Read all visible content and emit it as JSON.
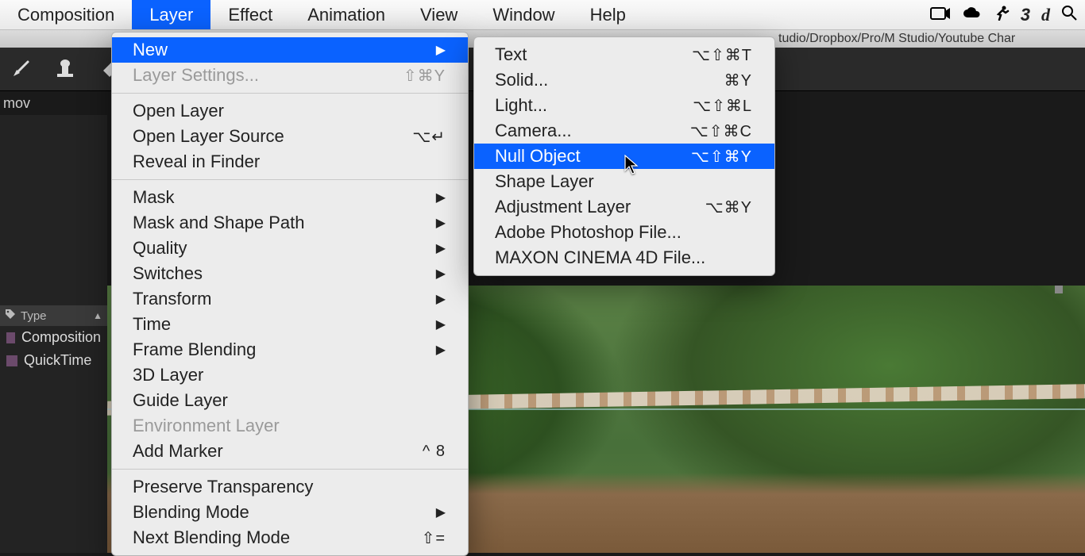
{
  "menubar": {
    "items": [
      "Composition",
      "Layer",
      "Effect",
      "Animation",
      "View",
      "Window",
      "Help"
    ],
    "active_index": 1
  },
  "titlebar": {
    "path": "tudio/Dropbox/Pro/M Studio/Youtube Char"
  },
  "tools": {
    "brush": "brush-icon",
    "stamp": "stamp-icon",
    "eraser": "eraser-icon"
  },
  "panel_tab": {
    "label": "mov"
  },
  "project": {
    "columns": {
      "type": "Type"
    },
    "rows": [
      {
        "name": "Composition",
        "type": "Composition"
      },
      {
        "name": "QuickTime",
        "type": "QuickTime"
      }
    ]
  },
  "layer_menu": {
    "groups": [
      [
        {
          "label": "New",
          "submenu": true,
          "highlight": true
        },
        {
          "label": "Layer Settings...",
          "shortcut": "⇧⌘Y",
          "disabled": true
        }
      ],
      [
        {
          "label": "Open Layer"
        },
        {
          "label": "Open Layer Source",
          "shortcut": "⌥↵"
        },
        {
          "label": "Reveal in Finder"
        }
      ],
      [
        {
          "label": "Mask",
          "submenu": true
        },
        {
          "label": "Mask and Shape Path",
          "submenu": true
        },
        {
          "label": "Quality",
          "submenu": true
        },
        {
          "label": "Switches",
          "submenu": true
        },
        {
          "label": "Transform",
          "submenu": true
        },
        {
          "label": "Time",
          "submenu": true
        },
        {
          "label": "Frame Blending",
          "submenu": true
        },
        {
          "label": "3D Layer"
        },
        {
          "label": "Guide Layer"
        },
        {
          "label": "Environment Layer",
          "disabled": true
        },
        {
          "label": "Add Marker",
          "shortcut": "^ 8"
        }
      ],
      [
        {
          "label": "Preserve Transparency"
        },
        {
          "label": "Blending Mode",
          "submenu": true
        },
        {
          "label": "Next Blending Mode",
          "shortcut": "⇧="
        }
      ]
    ]
  },
  "new_submenu": {
    "items": [
      {
        "label": "Text",
        "shortcut": "⌥⇧⌘T"
      },
      {
        "label": "Solid...",
        "shortcut": "⌘Y"
      },
      {
        "label": "Light...",
        "shortcut": "⌥⇧⌘L"
      },
      {
        "label": "Camera...",
        "shortcut": "⌥⇧⌘C"
      },
      {
        "label": "Null Object",
        "shortcut": "⌥⇧⌘Y",
        "highlight": true
      },
      {
        "label": "Shape Layer"
      },
      {
        "label": "Adjustment Layer",
        "shortcut": "⌥⌘Y"
      },
      {
        "label": "Adobe Photoshop File..."
      },
      {
        "label": "MAXON CINEMA 4D File..."
      }
    ]
  },
  "tray": {
    "glyphs": [
      "▭",
      "☁",
      "✦",
      "3",
      "d",
      "◯"
    ]
  }
}
